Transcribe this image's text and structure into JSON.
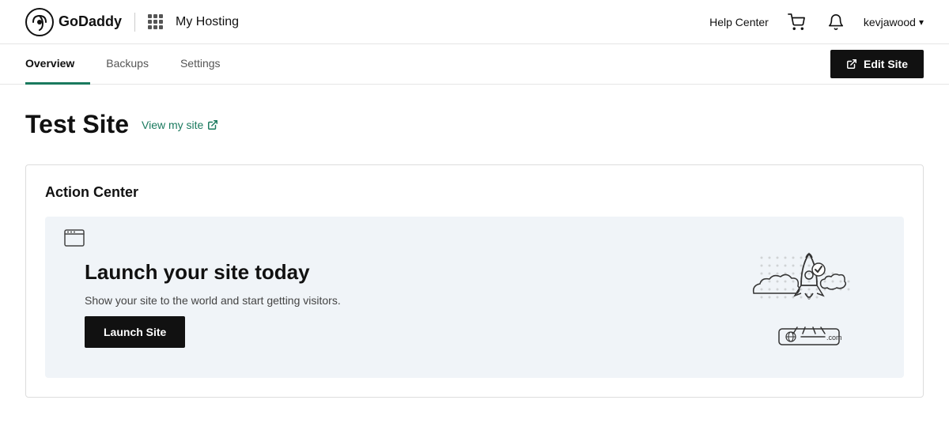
{
  "header": {
    "logo_text": "GoDaddy",
    "my_hosting_label": "My Hosting",
    "help_center_label": "Help Center",
    "username": "kevjawood",
    "chevron": "▾"
  },
  "nav": {
    "tabs": [
      {
        "id": "overview",
        "label": "Overview",
        "active": true
      },
      {
        "id": "backups",
        "label": "Backups",
        "active": false
      },
      {
        "id": "settings",
        "label": "Settings",
        "active": false
      }
    ],
    "edit_site_label": "Edit Site"
  },
  "main": {
    "page_title": "Test Site",
    "view_site_label": "View my site"
  },
  "action_center": {
    "title": "Action Center",
    "launch_title": "Launch your site today",
    "launch_desc": "Show your site to the world and start getting visitors.",
    "launch_btn_label": "Launch Site"
  }
}
